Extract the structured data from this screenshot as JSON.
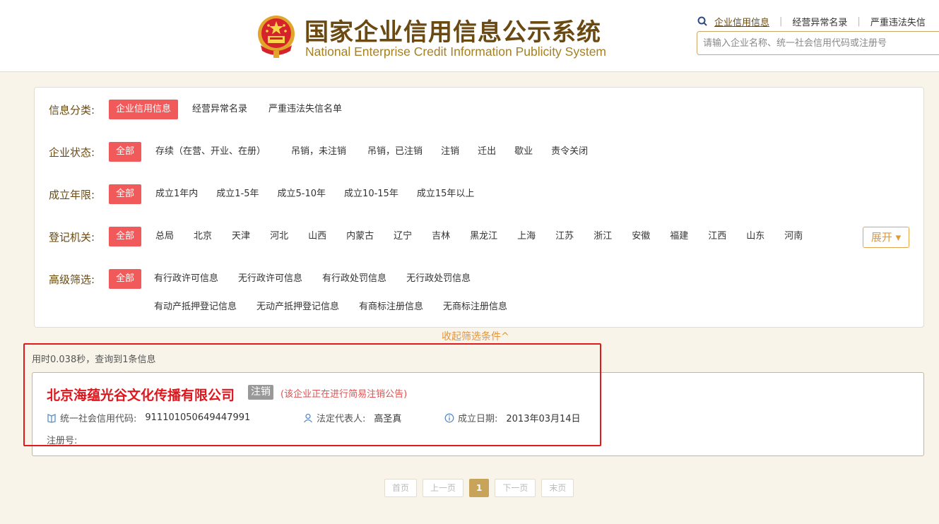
{
  "header": {
    "title_cn": "国家企业信用信息公示系统",
    "title_en": "National Enterprise Credit Information Publicity System",
    "links": [
      "企业信用信息",
      "经营异常名录",
      "严重违法失信"
    ],
    "search_placeholder": "请输入企业名称、统一社会信用代码或注册号"
  },
  "filters": {
    "category": {
      "label": "信息分类:",
      "options": [
        "企业信用信息",
        "经营异常名录",
        "严重违法失信名单"
      ],
      "selected": 0
    },
    "status": {
      "label": "企业状态:",
      "options": [
        "全部",
        "存续（在营、开业、在册）",
        "吊销，未注销",
        "吊销，已注销",
        "注销",
        "迁出",
        "歇业",
        "责令关闭"
      ],
      "selected": 0
    },
    "years": {
      "label": "成立年限:",
      "options": [
        "全部",
        "成立1年内",
        "成立1-5年",
        "成立5-10年",
        "成立10-15年",
        "成立15年以上"
      ],
      "selected": 0
    },
    "authority": {
      "label": "登记机关:",
      "options": [
        "全部",
        "总局",
        "北京",
        "天津",
        "河北",
        "山西",
        "内蒙古",
        "辽宁",
        "吉林",
        "黑龙江",
        "上海",
        "江苏",
        "浙江",
        "安徽",
        "福建",
        "江西",
        "山东",
        "河南"
      ],
      "selected": 0,
      "expand_label": "展开 ▾"
    },
    "advanced": {
      "label": "高级筛选:",
      "options_row1": [
        "全部",
        "有行政许可信息",
        "无行政许可信息",
        "有行政处罚信息",
        "无行政处罚信息"
      ],
      "options_row2": [
        "有动产抵押登记信息",
        "无动产抵押登记信息",
        "有商标注册信息",
        "无商标注册信息"
      ],
      "selected": 0
    },
    "collapse_label": "收起筛选条件^"
  },
  "results": {
    "info": "用时0.038秒，查询到1条信息",
    "items": [
      {
        "name": "北京海蕴光谷文化传播有限公司",
        "status": "注销",
        "notice": "(该企业正在进行简易注销公告)",
        "credit_code_label": "统一社会信用代码:",
        "credit_code": "911101050649447991",
        "legal_rep_label": "法定代表人:",
        "legal_rep": "高圣真",
        "founded_label": "成立日期:",
        "founded": "2013年03月14日",
        "reg_no_label": "注册号:"
      }
    ]
  },
  "pagination": {
    "first": "首页",
    "prev": "上一页",
    "current": "1",
    "next": "下一页",
    "last": "末页"
  },
  "colors": {
    "accent": "#f05a5a",
    "brand": "#6b4a12",
    "highlight": "#e11b1b"
  }
}
